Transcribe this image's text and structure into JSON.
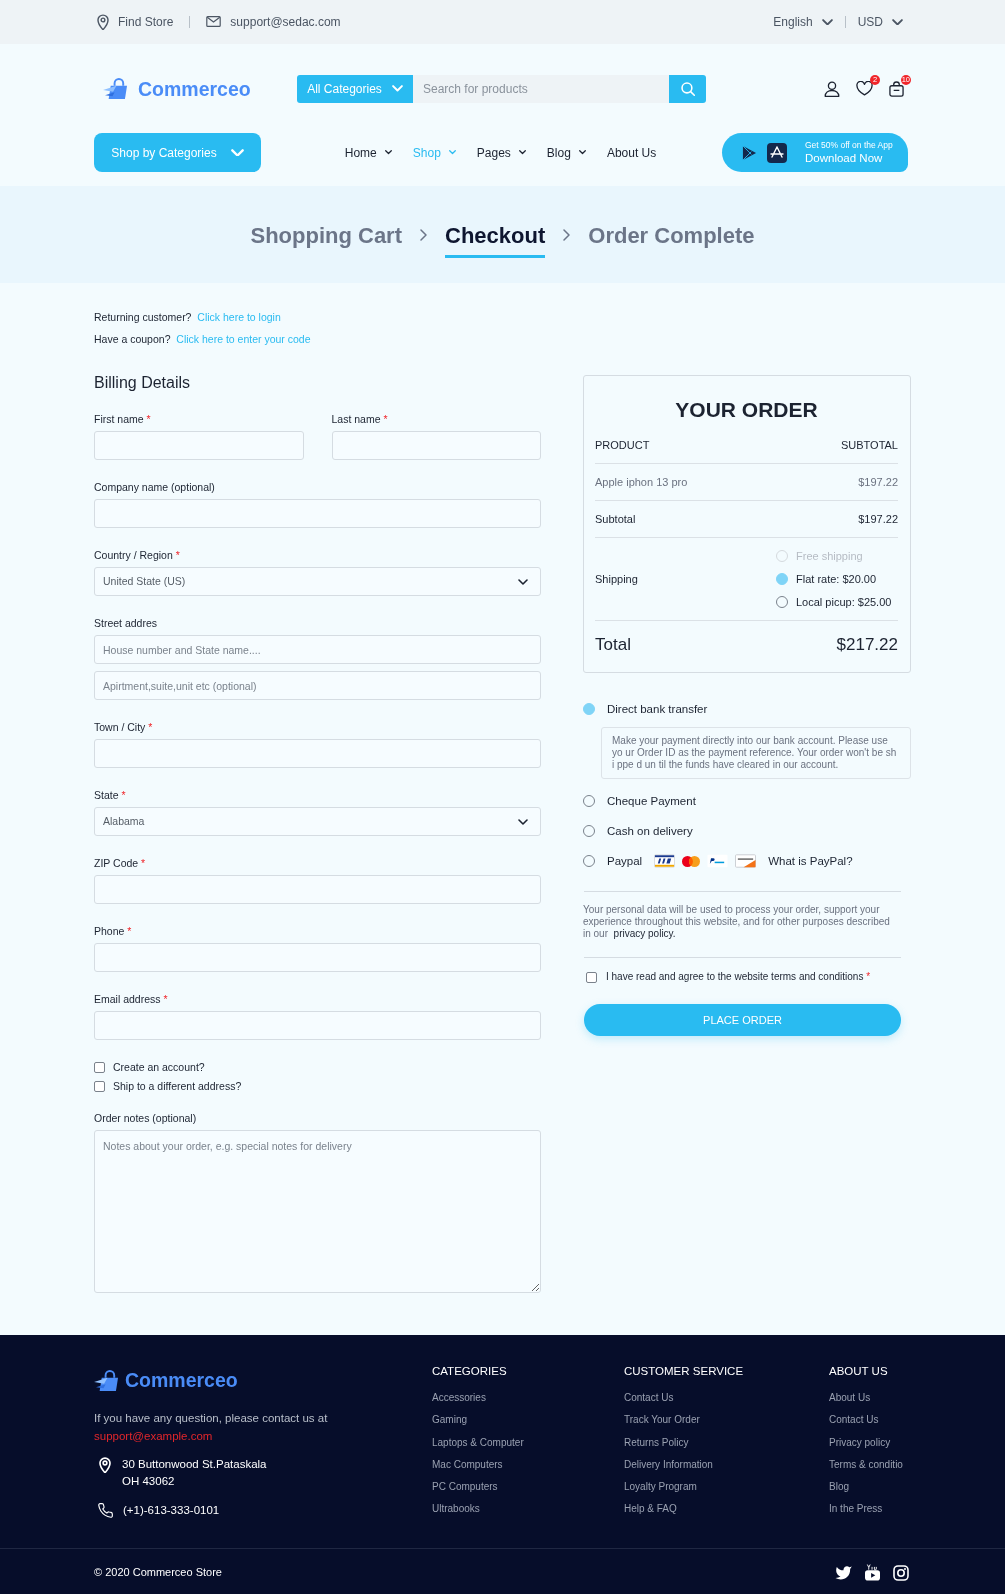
{
  "top_bar": {
    "contacts": [
      {
        "kind": "location",
        "text": "Find Store"
      },
      {
        "kind": "mail",
        "text": "support@sedac.com"
      }
    ],
    "selectors": [
      {
        "value": "English"
      },
      {
        "value": "USD"
      }
    ]
  },
  "header": {
    "logo": "Commerceo",
    "category_select": "All Categories",
    "search": {
      "placeholder": "Search for products"
    },
    "actions": [
      {
        "kind": "account"
      },
      {
        "kind": "wishlist",
        "count": "2"
      },
      {
        "kind": "cart",
        "count": "10"
      }
    ]
  },
  "nav": {
    "categories_button": "Shop by Categories",
    "links": [
      {
        "label": "Home",
        "dropdown": true,
        "selected": false
      },
      {
        "label": "Shop",
        "dropdown": true,
        "selected": true
      },
      {
        "label": "Pages",
        "dropdown": true,
        "selected": false
      },
      {
        "label": "Blog",
        "dropdown": true,
        "selected": false
      },
      {
        "label": "About Us",
        "dropdown": false,
        "selected": false
      }
    ],
    "app_banner": {
      "offer": "Get 50% off on the App",
      "action": "Download Now"
    }
  },
  "steps": [
    {
      "label": "Shopping Cart",
      "selected": false
    },
    {
      "label": "Checkout",
      "selected": true
    },
    {
      "label": "Order Complete",
      "selected": false
    }
  ],
  "notices": [
    {
      "text": "Returning customer?",
      "link": "Click here to login"
    },
    {
      "text": "Have a coupon?",
      "link": "Click here to enter your code"
    }
  ],
  "billing": {
    "title": "Billing Details",
    "rows": [
      {
        "fields": [
          {
            "kind": "text",
            "label": "First name",
            "required_mark": "*"
          },
          {
            "kind": "text",
            "label": "Last name",
            "required_mark": "*"
          }
        ]
      },
      {
        "fields": [
          {
            "kind": "text",
            "label": "Company name (optional)"
          }
        ]
      },
      {
        "fields": [
          {
            "kind": "select",
            "label": "Country / Region",
            "required_mark": "*",
            "value": "United State (US)"
          }
        ]
      },
      {
        "fields": [
          {
            "kind": "text",
            "label": "Street addres",
            "placeholders": [
              "House number and State name....",
              "Apirtment,suite,unit etc (optional)"
            ]
          }
        ]
      },
      {
        "fields": [
          {
            "kind": "text",
            "label": "Town / City",
            "required_mark": "*"
          }
        ]
      },
      {
        "fields": [
          {
            "kind": "select",
            "label": "State",
            "required_mark": "*",
            "value": "Alabama"
          }
        ]
      },
      {
        "fields": [
          {
            "kind": "text",
            "label": "ZIP Code",
            "required_mark": "*"
          }
        ]
      },
      {
        "fields": [
          {
            "kind": "text",
            "label": "Phone",
            "required_mark": "*"
          }
        ]
      },
      {
        "fields": [
          {
            "kind": "text",
            "label": "Email address",
            "required_mark": "*"
          }
        ]
      }
    ],
    "options": [
      {
        "label": "Create an account?",
        "checked": false
      },
      {
        "label": "Ship to a different address?",
        "checked": false
      }
    ],
    "notes": {
      "label": "Order notes (optional)",
      "placeholder": "Notes about your order, e.g. special notes for delivery"
    }
  },
  "order": {
    "title": "YOUR ORDER",
    "columns": [
      "PRODUCT",
      "SUBTOTAL"
    ],
    "items": [
      {
        "name": "Apple iphon 13 pro",
        "price": "$197.22"
      }
    ],
    "subtotal": {
      "label": "Subtotal",
      "value": "$197.22"
    },
    "shipping": {
      "label": "Shipping",
      "options": [
        {
          "label": "Free shipping",
          "selected": false,
          "disabled": true
        },
        {
          "label": "Flat rate: $20.00",
          "selected": true,
          "disabled": false
        },
        {
          "label": "Local picup: $25.00",
          "selected": false,
          "disabled": false
        }
      ]
    },
    "total": {
      "label": "Total",
      "value": "$217.22"
    }
  },
  "payment": {
    "methods": [
      {
        "label": "Direct bank transfer",
        "selected": true,
        "description": "Make your payment directly into our bank account. Please use yo ur Order ID as the payment reference. Your order won't be sh i ppe d un til the funds have cleared in our account."
      },
      {
        "label": "Cheque Payment",
        "selected": false
      },
      {
        "label": "Cash on delivery",
        "selected": false
      },
      {
        "label": "Paypal",
        "selected": false,
        "cards": [
          {
            "kind": "visa"
          },
          {
            "kind": "mastercard"
          },
          {
            "kind": "paypal"
          },
          {
            "kind": "discover"
          }
        ],
        "link": "What is PayPal?"
      }
    ],
    "privacy_note": {
      "text": "Your personal data will be used to process your order, support your experience throughout this website, and for other purposes described in our",
      "link": "privacy policy."
    },
    "terms": {
      "label": "I have read and agree to the website terms and conditions",
      "required_mark": "*",
      "checked": false
    },
    "place_order": "PLACE ORDER"
  },
  "footer": {
    "logo": "Commerceo",
    "contact_text": "If you have any question, please contact us at",
    "email": "support@example.com",
    "address": [
      "30 Buttonwood St.Pataskala",
      "OH 43062"
    ],
    "phone": "(+1)-613-333-0101",
    "columns": [
      {
        "title": "CATEGORIES",
        "links": [
          "Accessories",
          "Gaming",
          "Laptops & Computer",
          "Mac Computers",
          "PC Computers",
          "Ultrabooks"
        ]
      },
      {
        "title": "CUSTOMER SERVICE",
        "links": [
          "Contact Us",
          "Track Your Order",
          "Returns Policy",
          "Delivery Information",
          "Loyalty Program",
          "Help & FAQ"
        ]
      },
      {
        "title": "ABOUT US",
        "links": [
          "About Us",
          "Contact Us",
          "Privacy policy",
          "Terms & conditio",
          "Blog",
          "In the Press"
        ]
      }
    ],
    "copyright": "© 2020 Commerceo Store",
    "social": [
      {
        "kind": "twitter"
      },
      {
        "kind": "youtube"
      },
      {
        "kind": "instagram"
      }
    ]
  }
}
